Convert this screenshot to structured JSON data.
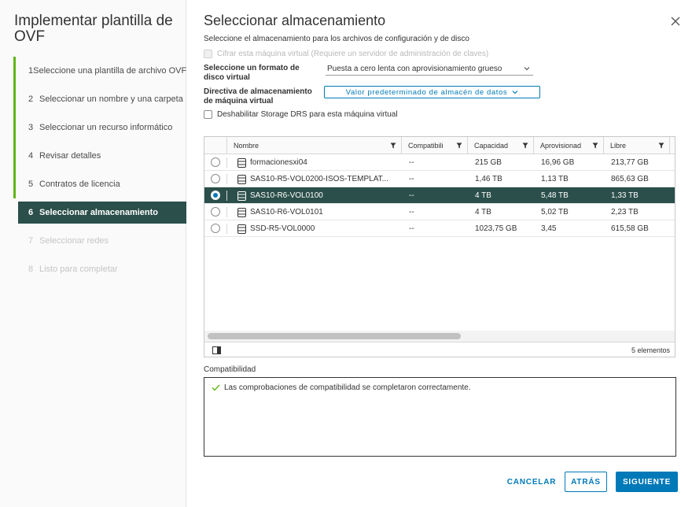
{
  "sidebar": {
    "title": "Implementar plantilla de OVF",
    "steps": [
      {
        "num": "1",
        "label": "Seleccione una plantilla de archivo OVF"
      },
      {
        "num": "2",
        "label": "Seleccionar un nombre y una carpeta"
      },
      {
        "num": "3",
        "label": "Seleccionar un recurso informático"
      },
      {
        "num": "4",
        "label": "Revisar detalles"
      },
      {
        "num": "5",
        "label": "Contratos de licencia"
      },
      {
        "num": "6",
        "label": "Seleccionar almacenamiento"
      },
      {
        "num": "7",
        "label": "Seleccionar redes"
      },
      {
        "num": "8",
        "label": "Listo para completar"
      }
    ]
  },
  "main": {
    "title": "Seleccionar almacenamiento",
    "subtitle": "Seleccione el almacenamiento para los archivos de configuración y de disco",
    "encrypt_label": "Cifrar esta máquina virtual (Requiere un servidor de administración de claves)",
    "disk_format_label": "Seleccione un formato de disco virtual",
    "disk_format_value": "Puesta a cero lenta con aprovisionamiento grueso",
    "policy_label": "Directiva de almacenamiento de máquina virtual",
    "policy_value": "Valor predeterminado de almacén de datos",
    "drs_label": "Deshabilitar Storage DRS para esta máquina virtual"
  },
  "grid": {
    "columns": [
      "Nombre",
      "Compatibili",
      "Capacidad",
      "Aprovisionad",
      "Libre"
    ],
    "rows": [
      {
        "name": "formacionesxi04",
        "compat": "--",
        "capacity": "215 GB",
        "provisioned": "16,96 GB",
        "free": "213,77 GB"
      },
      {
        "name": "SAS10-R5-VOL0200-ISOS-TEMPLAT...",
        "compat": "--",
        "capacity": "1,46 TB",
        "provisioned": "1,13 TB",
        "free": "865,63 GB"
      },
      {
        "name": "SAS10-R6-VOL0100",
        "compat": "--",
        "capacity": "4 TB",
        "provisioned": "5,48 TB",
        "free": "1,33 TB"
      },
      {
        "name": "SAS10-R6-VOL0101",
        "compat": "--",
        "capacity": "4 TB",
        "provisioned": "5,02 TB",
        "free": "2,23 TB"
      },
      {
        "name": "SSD-R5-VOL0000",
        "compat": "--",
        "capacity": "1023,75 GB",
        "provisioned": "3,45",
        "free": "615,58 GB"
      }
    ],
    "count": "5 elementos"
  },
  "compat": {
    "label": "Compatibilidad",
    "message": "Las comprobaciones de compatibilidad se completaron correctamente."
  },
  "buttons": {
    "cancel": "CANCELAR",
    "back": "ATRÁS",
    "next": "SIGUIENTE"
  },
  "colors": {
    "accent": "#0079b8",
    "selected_row": "#2b4f4a",
    "done_step": "#60b515"
  }
}
